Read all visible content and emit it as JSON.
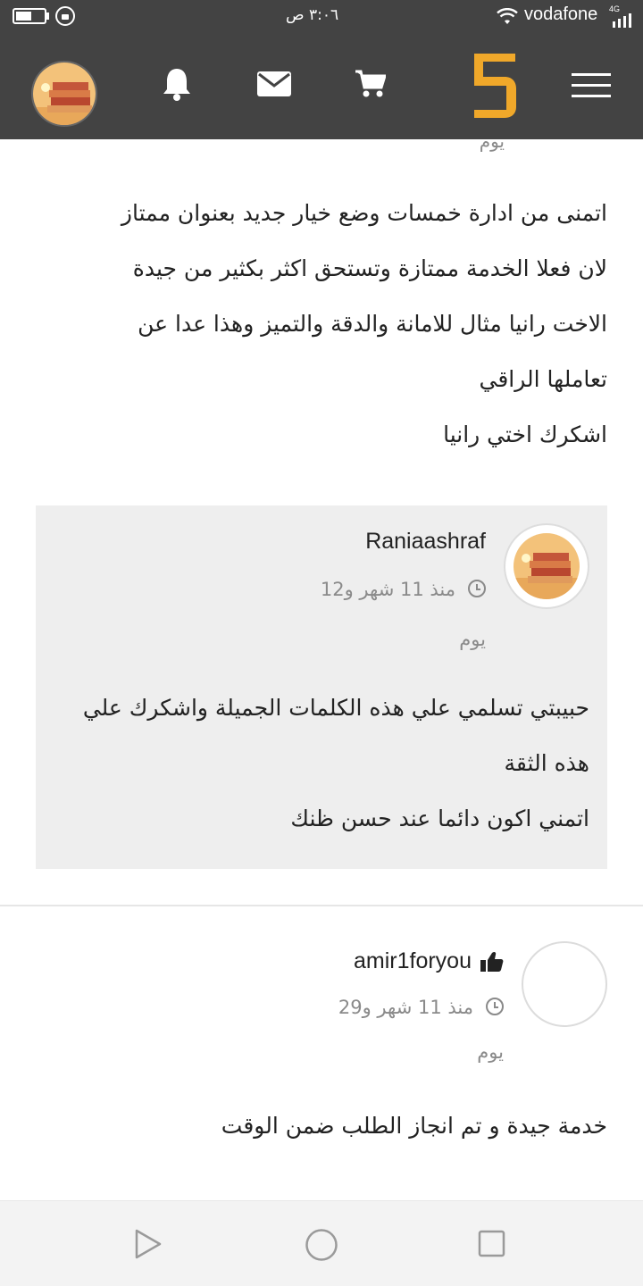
{
  "status_bar": {
    "time": "٣:٠٦ ص",
    "carrier": "vodafone",
    "network": "4G",
    "battery_level": 0.55
  },
  "app_header": {
    "icons": [
      "menu-icon",
      "logo-5",
      "cart-icon",
      "mail-icon",
      "bell-icon",
      "avatar"
    ],
    "brand_color": "#f0a82a",
    "bar_color": "#434343"
  },
  "review": {
    "meta_cut": "يوم",
    "body": [
      "اتمنى من ادارة خمسات وضع خيار جديد بعنوان ممتاز",
      "لان فعلا الخدمة ممتازة وتستحق اكثر بكثير من جيدة",
      "الاخت رانيا مثال للامانة والدقة والتميز وهذا عدا عن",
      "تعاملها الراقي",
      "اشكرك اختي رانيا"
    ]
  },
  "reply": {
    "username": "Raniaashraf",
    "time_ago": "منذ 11 شهر و12",
    "time_unit": "يوم",
    "body": [
      "حبيبتي تسلمي علي هذه الكلمات الجميلة واشكرك علي",
      "هذه الثقة",
      "اتمني اكون دائما عند حسن ظنك"
    ]
  },
  "review2": {
    "username": "amir1foryou",
    "time_ago": "منذ 11 شهر و29",
    "time_unit": "يوم",
    "body": "خدمة جيدة و تم انجاز الطلب ضمن الوقت"
  },
  "nav_bar": {
    "buttons": [
      "back-triangle",
      "home-circle",
      "recents-square"
    ]
  }
}
